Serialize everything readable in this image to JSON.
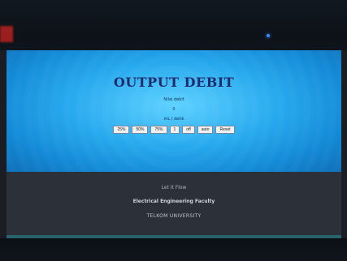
{
  "header": {
    "title": "OUTPUT DEBIT"
  },
  "content": {
    "line1": "Nilai debit",
    "line2": "0",
    "line3": "mL / detik"
  },
  "buttons": [
    {
      "label": "25%"
    },
    {
      "label": "50%"
    },
    {
      "label": "75%"
    },
    {
      "label": "1"
    },
    {
      "label": "off"
    },
    {
      "label": "auto"
    },
    {
      "label": "Reset"
    }
  ],
  "footer": {
    "tagline": "Let It Flow",
    "faculty": "Electrical Engineering Faculty",
    "university": "TELKOM UNIVERSITY"
  }
}
